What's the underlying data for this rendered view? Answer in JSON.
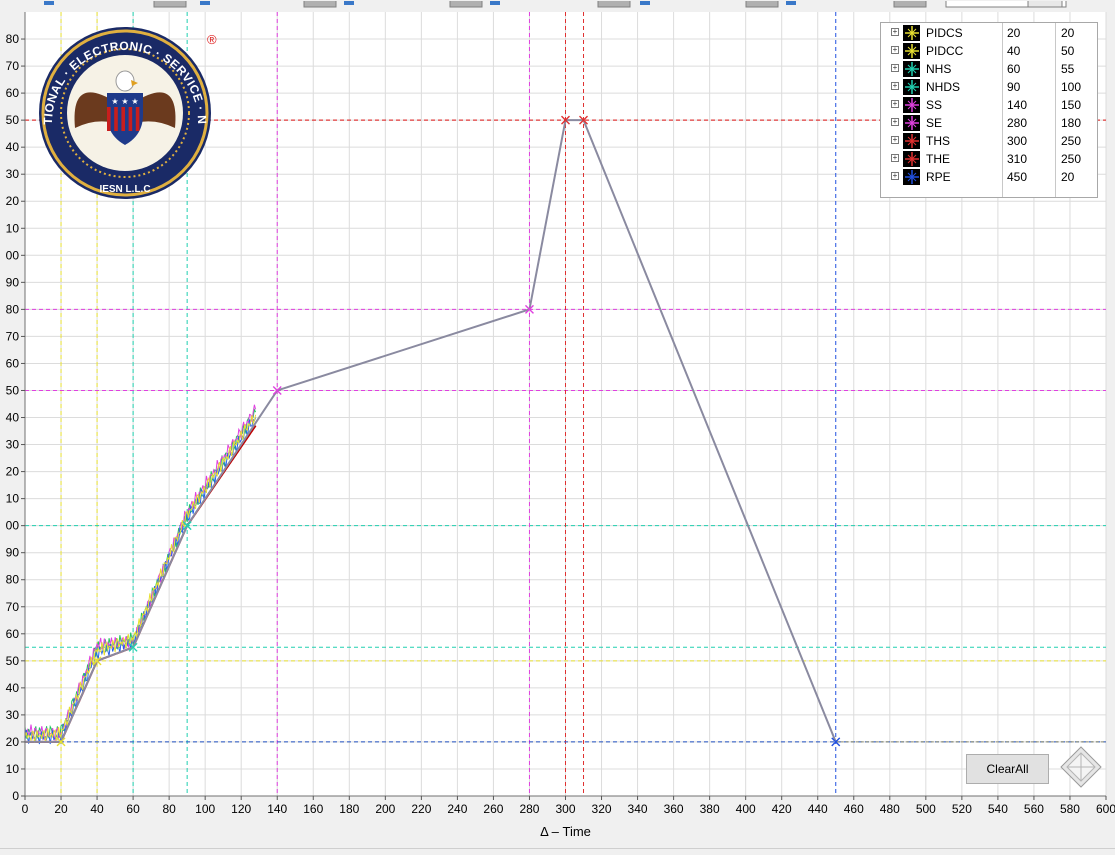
{
  "chart_data": {
    "type": "line",
    "xlabel": "Δ – Time",
    "x_ticks": [
      0,
      20,
      40,
      60,
      80,
      100,
      120,
      140,
      160,
      180,
      200,
      220,
      240,
      260,
      280,
      300,
      320,
      340,
      360,
      380,
      400,
      420,
      440,
      460,
      480,
      500,
      520,
      540,
      560,
      580,
      600
    ],
    "xlim": [
      0,
      600
    ],
    "ylim": [
      0,
      290
    ],
    "grid": true,
    "setpoint_profile": {
      "x": [
        0,
        20,
        40,
        60,
        90,
        140,
        280,
        300,
        310,
        450
      ],
      "y": [
        20,
        20,
        50,
        55,
        100,
        150,
        180,
        250,
        250,
        20
      ],
      "color": "#8a8aa0"
    },
    "measured_traces": [
      {
        "color": "#c00000",
        "x": [
          0,
          20,
          40,
          60,
          90,
          128
        ],
        "y": [
          20,
          20,
          50,
          55,
          100,
          137
        ]
      },
      {
        "color": "#22c55e",
        "x": [
          0,
          20,
          40,
          60,
          90,
          128
        ],
        "y": [
          23,
          24,
          55,
          58,
          104,
          142
        ]
      },
      {
        "color": "#e040e0",
        "x": [
          0,
          20,
          40,
          60,
          90,
          128
        ],
        "y": [
          24,
          23,
          56,
          57,
          105,
          143
        ]
      },
      {
        "color": "#2563eb",
        "x": [
          0,
          20,
          40,
          60,
          90,
          128
        ],
        "y": [
          22,
          22,
          53,
          57,
          103,
          140
        ]
      },
      {
        "color": "#e8e030",
        "x": [
          0,
          20,
          40,
          60,
          90,
          128
        ],
        "y": [
          22,
          23,
          54,
          58,
          104,
          141
        ]
      }
    ],
    "cursors": [
      {
        "name": "PIDCS",
        "x": 20,
        "y": 20,
        "color": "#e8e030"
      },
      {
        "name": "PIDCC",
        "x": 40,
        "y": 50,
        "color": "#e8e030"
      },
      {
        "name": "NHS",
        "x": 60,
        "y": 55,
        "color": "#20d0b0"
      },
      {
        "name": "NHDS",
        "x": 90,
        "y": 100,
        "color": "#20d0b0"
      },
      {
        "name": "SS",
        "x": 140,
        "y": 150,
        "color": "#e040e0"
      },
      {
        "name": "SE",
        "x": 280,
        "y": 180,
        "color": "#e040e0"
      },
      {
        "name": "THS",
        "x": 300,
        "y": 250,
        "color": "#e03030"
      },
      {
        "name": "THE",
        "x": 310,
        "y": 250,
        "color": "#e03030"
      },
      {
        "name": "RPE",
        "x": 450,
        "y": 20,
        "color": "#2050e0"
      }
    ]
  },
  "buttons": {
    "clear_all": "ClearAll"
  },
  "logo": {
    "text": "INTERNATIONAL · ELECTRONIC · SERVICE · NETWORK",
    "sub": "IESN L.L.C",
    "registered": "®"
  },
  "colors": {
    "plot_background": "#ffffff",
    "grid": "#dcdcdc"
  }
}
